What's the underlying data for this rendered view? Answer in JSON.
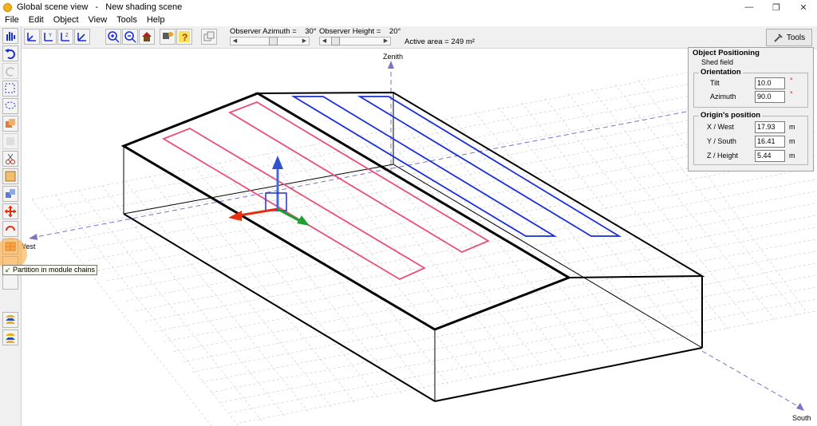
{
  "window": {
    "title": "Global scene view   -   New shading scene",
    "controls": [
      "—",
      "❐",
      "✕"
    ]
  },
  "menu": [
    "File",
    "Edit",
    "Object",
    "View",
    "Tools",
    "Help"
  ],
  "toolbar": {
    "azimuth_label": "Observer Azimuth =    30°",
    "height_label": "Observer Height =    20°",
    "azimuth_value_deg": 30,
    "height_value_deg": 20,
    "active_area": "Active area = 249 m²",
    "tools_label": "Tools"
  },
  "scene": {
    "axis_zenith": "Zenith",
    "axis_west": "West",
    "axis_south": "South",
    "colors": {
      "red_fields": "#e8507a",
      "blue_fields": "#1a2fd6",
      "grid": "#c9c9c9",
      "axis": "#8070c8"
    }
  },
  "panel": {
    "title": "Object Positioning",
    "subtitle": "Shed field",
    "orientation_title": "Orientation",
    "tilt_label": "Tilt",
    "tilt_value": "10.0",
    "azimuth_label": "Azimuth",
    "azimuth_value": "90.0",
    "degree_mark": "°",
    "origin_title": "Origin's position",
    "x_label": "X / West",
    "x_value": "17.93",
    "y_label": "Y / South",
    "y_value": "16.41",
    "z_label": "Z / Height",
    "z_value": "5.44",
    "unit": "m"
  },
  "tooltip": "Partition in module chains"
}
